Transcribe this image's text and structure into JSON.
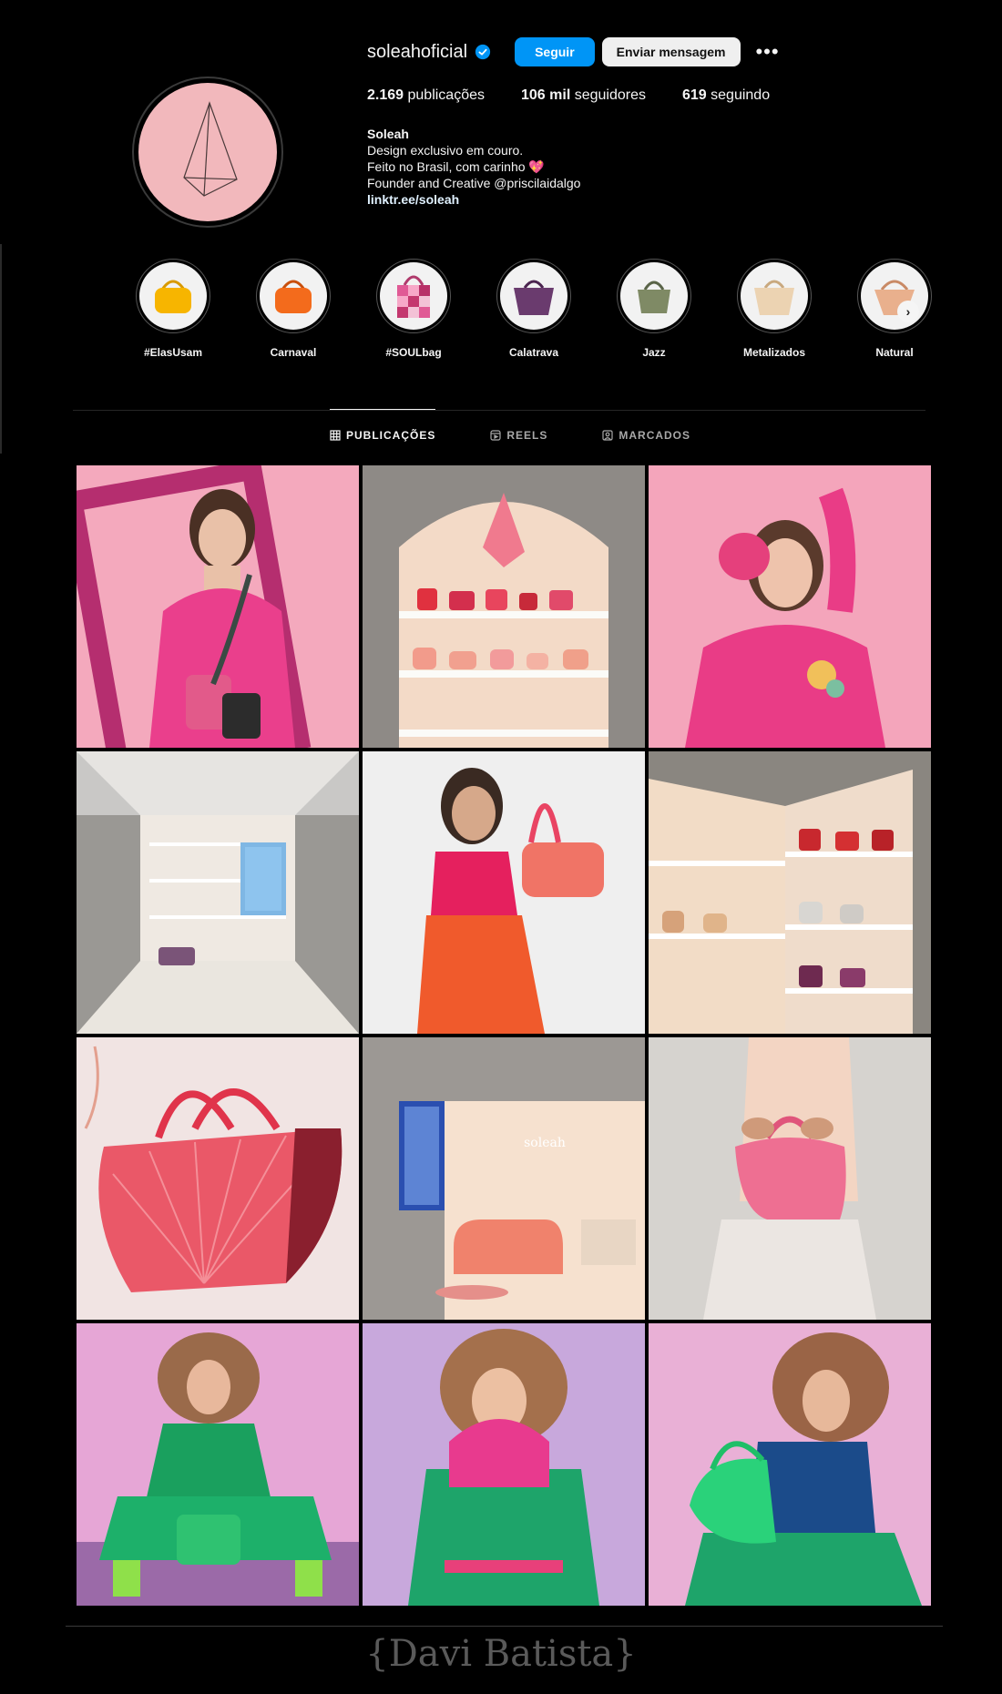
{
  "profile": {
    "username": "soleahoficial",
    "follow_label": "Seguir",
    "message_label": "Enviar mensagem",
    "more_label": "•••",
    "stats": {
      "posts_value": "2.169",
      "posts_label": "publicações",
      "followers_value": "106 mil",
      "followers_label": "seguidores",
      "following_value": "619",
      "following_label": "seguindo"
    },
    "bio": {
      "name": "Soleah",
      "line1": "Design exclusivo em couro.",
      "line2": "Feito no Brasil, com carinho 💖",
      "line3": "Founder and Creative @priscilaidalgo",
      "link": "linktr.ee/soleah"
    }
  },
  "highlights": [
    {
      "label": "#ElasUsam",
      "color": "#f7b500"
    },
    {
      "label": "Carnaval",
      "color": "#f36b1c"
    },
    {
      "label": "#SOULbag",
      "color": "#d94d8a"
    },
    {
      "label": "Calatrava",
      "color": "#6a3b6e"
    },
    {
      "label": "Jazz",
      "color": "#7f8a65"
    },
    {
      "label": "Metalizados",
      "color": "#ecd3b2"
    },
    {
      "label": "Natural",
      "color": "#e9b08d"
    }
  ],
  "highlights_next": "›",
  "tabs": {
    "posts": "PUBLICAÇÕES",
    "reels": "REELS",
    "tagged": "MARCADOS"
  },
  "posts": [
    {
      "label": "model-pink-frame"
    },
    {
      "label": "store-shelves-arch"
    },
    {
      "label": "model-pink-hoodie"
    },
    {
      "label": "store-interior"
    },
    {
      "label": "model-red-bag"
    },
    {
      "label": "store-shelves-side"
    },
    {
      "label": "fan-bag"
    },
    {
      "label": "store-sofa"
    },
    {
      "label": "pink-pouch-bag"
    },
    {
      "label": "model-curly-seated"
    },
    {
      "label": "model-curly-clutch"
    },
    {
      "label": "model-curly-green-bag"
    }
  ],
  "watermark": "{Davi Batista}",
  "colors": {
    "accent": "#0095f6",
    "background": "#000000",
    "avatar_bg": "#f2b8bc"
  }
}
